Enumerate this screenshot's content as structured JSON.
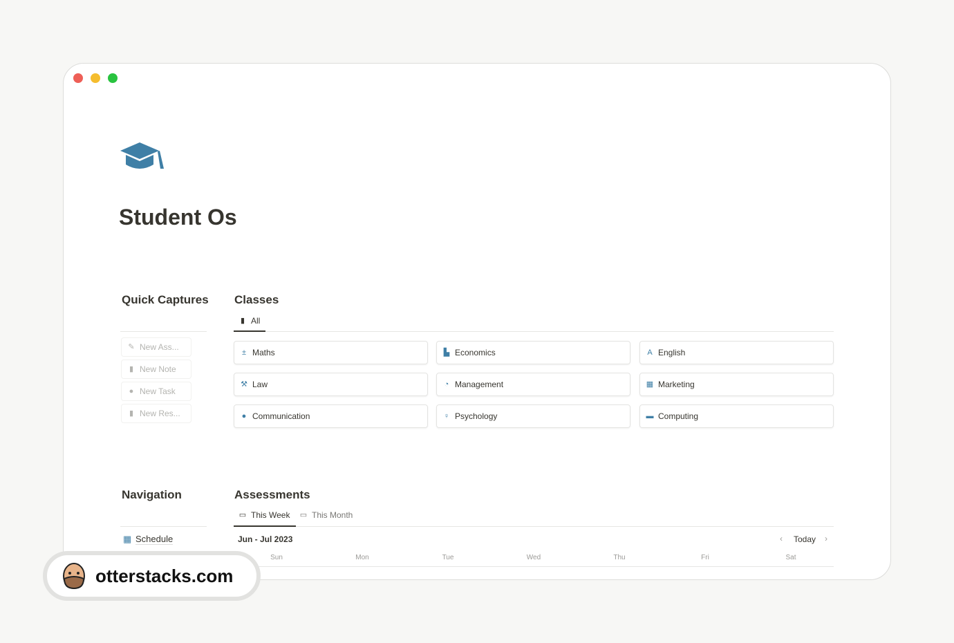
{
  "page": {
    "title": "Student Os",
    "icon": "graduation-cap-icon"
  },
  "quick_captures": {
    "heading": "Quick Captures",
    "items": [
      {
        "label": "New Ass...",
        "icon": "edit-list-icon"
      },
      {
        "label": "New Note",
        "icon": "document-icon"
      },
      {
        "label": "New Task",
        "icon": "check-circle-icon"
      },
      {
        "label": "New Res...",
        "icon": "bookmark-icon"
      }
    ]
  },
  "classes": {
    "heading": "Classes",
    "tab": "All",
    "items": [
      {
        "label": "Maths",
        "icon": "math-operators-icon"
      },
      {
        "label": "Economics",
        "icon": "chart-area-icon"
      },
      {
        "label": "English",
        "icon": "translate-icon"
      },
      {
        "label": "Law",
        "icon": "gavel-icon"
      },
      {
        "label": "Management",
        "icon": "donut-icon"
      },
      {
        "label": "Marketing",
        "icon": "trend-chart-icon"
      },
      {
        "label": "Communication",
        "icon": "chat-bubble-icon"
      },
      {
        "label": "Psychology",
        "icon": "head-icon"
      },
      {
        "label": "Computing",
        "icon": "monitor-icon"
      }
    ]
  },
  "navigation": {
    "heading": "Navigation",
    "items": [
      {
        "label": "Schedule",
        "icon": "calendar-icon"
      }
    ]
  },
  "assessments": {
    "heading": "Assessments",
    "tabs": [
      "This Week",
      "This Month"
    ],
    "range": "Jun - Jul 2023",
    "today": "Today",
    "days": [
      "Sun",
      "Mon",
      "Tue",
      "Wed",
      "Thu",
      "Fri",
      "Sat"
    ]
  },
  "watermark": {
    "text": "otterstacks.com"
  },
  "colors": {
    "accent": "#3f7fa6",
    "close": "#ee5f57",
    "minimize": "#f5bd2e",
    "maximize": "#29c33f"
  }
}
